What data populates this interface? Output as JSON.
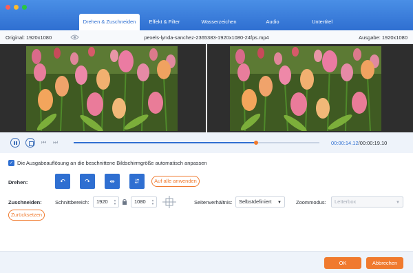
{
  "window": {
    "controls": [
      "close",
      "minimize",
      "zoom"
    ]
  },
  "tabs": [
    {
      "label": "Drehen & Zuschneiden",
      "active": true
    },
    {
      "label": "Effekt & Filter"
    },
    {
      "label": "Wasserzeichen"
    },
    {
      "label": "Audio"
    },
    {
      "label": "Untertitel"
    }
  ],
  "info": {
    "original": "Original: 1920x1080",
    "filename": "pexels-lynda-sanchez-2365383-1920x1080-24fps.mp4",
    "output": "Ausgabe: 1920x1080"
  },
  "player": {
    "progress": 0.742,
    "time_current": "00:00:14.12",
    "time_total": "/00:00:19.10"
  },
  "settings": {
    "auto_adjust_label": "Die Ausgabeauflösung an die beschnittene Bildschirmgröße automatisch anpassen",
    "auto_adjust_checked": true,
    "rotate_label": "Drehen:",
    "rotate_buttons": [
      "rotate-left",
      "rotate-right",
      "flip-horizontal",
      "flip-vertical"
    ],
    "apply_all_label": "Auf alle anwenden",
    "crop_label": "Zuschneiden:",
    "crop_area_label": "Schnittbereich:",
    "crop_width": "1920",
    "crop_height": "1080",
    "aspect_label": "Seitenverhältnis:",
    "aspect_value": "Selbstdefiniert",
    "zoom_label": "Zoommodus:",
    "zoom_value": "Letterbox",
    "reset_label": "Zurücksetzen"
  },
  "footer": {
    "ok_label": "OK",
    "cancel_label": "Abbrechen"
  },
  "colors": {
    "accent": "#2f6fd1",
    "orange": "#f07a2e"
  }
}
